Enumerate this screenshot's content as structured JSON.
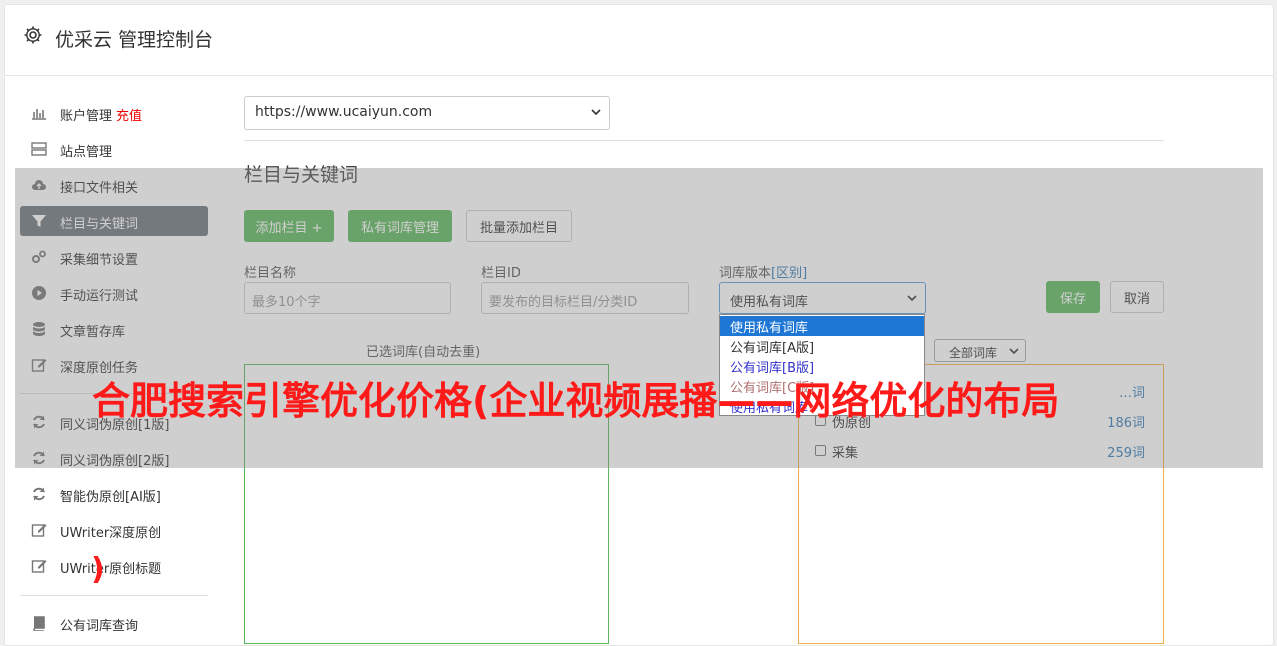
{
  "header": {
    "title": "优采云 管理控制台"
  },
  "sidebar": {
    "items": [
      {
        "label": "账户管理",
        "extra": "充值",
        "icon": "bar-chart-icon"
      },
      {
        "label": "站点管理",
        "icon": "server-icon"
      },
      {
        "label": "接口文件相关",
        "icon": "cloud-upload-icon"
      },
      {
        "label": "栏目与关键词",
        "icon": "filter-icon",
        "active": true
      },
      {
        "label": "采集细节设置",
        "icon": "gears-icon"
      },
      {
        "label": "手动运行测试",
        "icon": "play-circle-icon"
      },
      {
        "label": "文章暂存库",
        "icon": "database-icon"
      },
      {
        "label": "深度原创任务",
        "icon": "edit-icon"
      },
      {
        "label": "同义词伪原创[1版]",
        "icon": "refresh-icon"
      },
      {
        "label": "同义词伪原创[2版]",
        "icon": "refresh-icon"
      },
      {
        "label": "智能伪原创[AI版]",
        "icon": "refresh-icon"
      },
      {
        "label": "UWriter深度原创",
        "icon": "edit-icon"
      },
      {
        "label": "UWriter原创标题",
        "icon": "edit-icon"
      },
      {
        "label": "公有词库查询",
        "icon": "book-icon"
      }
    ]
  },
  "main": {
    "site_select": "https://www.ucaiyun.com",
    "section_title": "栏目与关键词",
    "buttons": {
      "add_column": "添加栏目 +",
      "private_lib": "私有词库管理",
      "batch_add": "批量添加栏目",
      "save": "保存",
      "cancel": "取消"
    },
    "form": {
      "name_label": "栏目名称",
      "name_placeholder": "最多10个字",
      "id_label": "栏目ID",
      "id_placeholder": "要发布的目标栏目/分类ID",
      "version_label": "词库版本",
      "version_label_link": "[区别]",
      "version_value": "使用私有词库"
    },
    "selected_box_title": "已选词库(自动去重)",
    "lib_filter": "全部词库",
    "dropdown": {
      "options": [
        "使用私有词库",
        "公有词库[A版]",
        "公有词库[B版]",
        "公有词库[C版]",
        "使用私有词库"
      ]
    },
    "libraries": [
      {
        "name": "",
        "count": "…词"
      },
      {
        "name": "伪原创",
        "count": "186词"
      },
      {
        "name": "采集",
        "count": "259词"
      }
    ]
  },
  "overlay": {
    "banner": "合肥搜索引擎优化价格(企业视频展播——网络优化的布局",
    "paren": ")"
  },
  "colors": {
    "green": "#5cb85c",
    "banner_red": "#ff1a1a",
    "link_blue": "#337ab7",
    "active_gray": "#6c757d"
  }
}
